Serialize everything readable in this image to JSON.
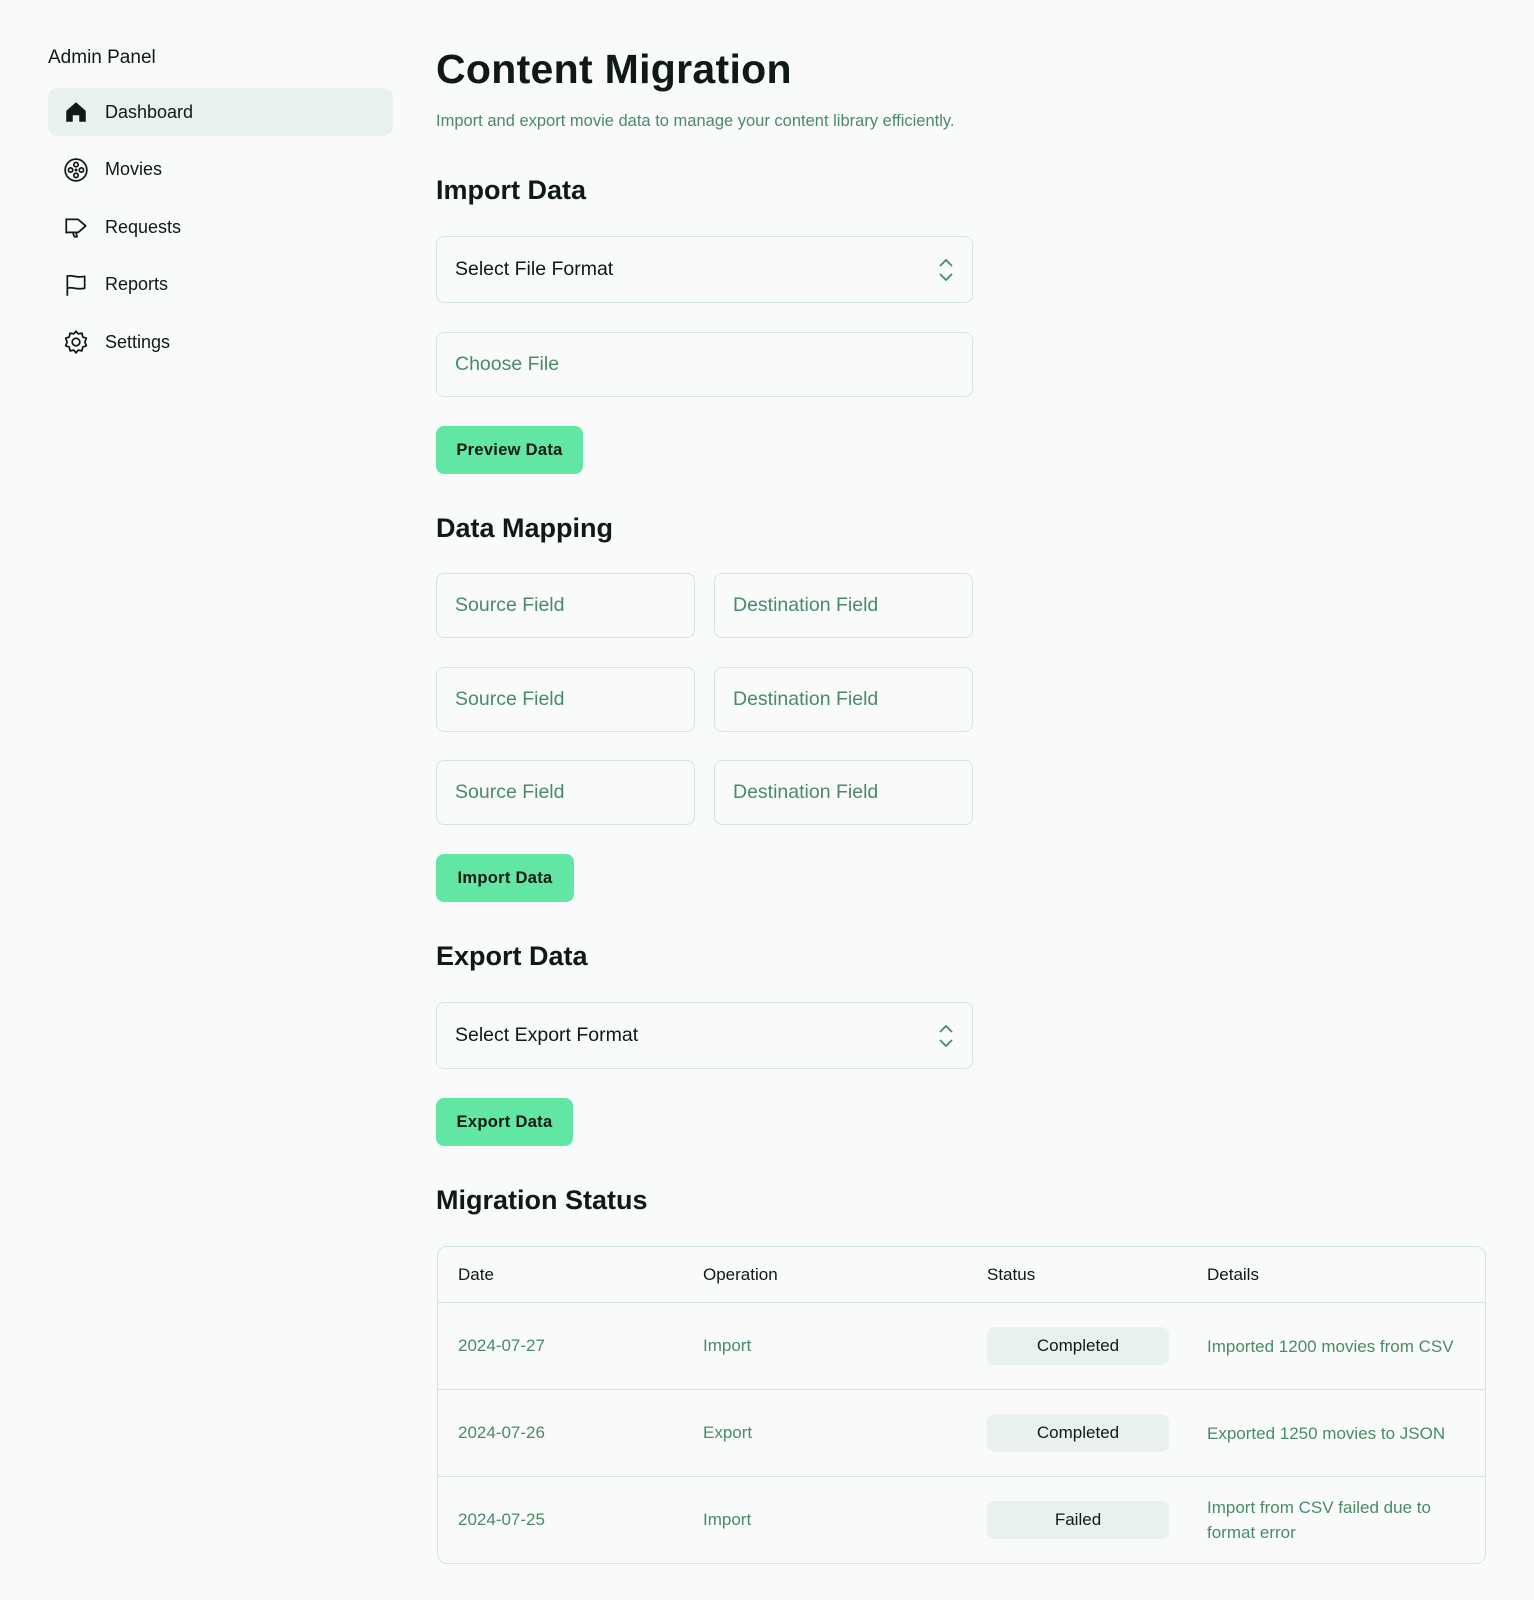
{
  "sidebar": {
    "title": "Admin Panel",
    "items": [
      {
        "label": "Dashboard",
        "icon": "home-icon",
        "active": true
      },
      {
        "label": "Movies",
        "icon": "film-reel-icon",
        "active": false
      },
      {
        "label": "Requests",
        "icon": "megaphone-icon",
        "active": false
      },
      {
        "label": "Reports",
        "icon": "flag-icon",
        "active": false
      },
      {
        "label": "Settings",
        "icon": "gear-icon",
        "active": false
      }
    ]
  },
  "header": {
    "title": "Content Migration",
    "subtitle": "Import and export movie data to manage your content library efficiently."
  },
  "import_section": {
    "title": "Import Data",
    "file_format_select": "Select File Format",
    "choose_file_placeholder": "Choose File",
    "preview_button": "Preview Data"
  },
  "mapping_section": {
    "title": "Data Mapping",
    "rows": [
      {
        "source_placeholder": "Source Field",
        "destination_placeholder": "Destination Field"
      },
      {
        "source_placeholder": "Source Field",
        "destination_placeholder": "Destination Field"
      },
      {
        "source_placeholder": "Source Field",
        "destination_placeholder": "Destination Field"
      }
    ],
    "import_button": "Import Data"
  },
  "export_section": {
    "title": "Export Data",
    "format_select": "Select Export Format",
    "export_button": "Export Data"
  },
  "status_section": {
    "title": "Migration Status",
    "columns": [
      "Date",
      "Operation",
      "Status",
      "Details"
    ],
    "rows": [
      {
        "date": "2024-07-27",
        "operation": "Import",
        "status": "Completed",
        "details": "Imported 1200 movies from CSV"
      },
      {
        "date": "2024-07-26",
        "operation": "Export",
        "status": "Completed",
        "details": "Exported 1250 movies to JSON"
      },
      {
        "date": "2024-07-25",
        "operation": "Import",
        "status": "Failed",
        "details": "Import from CSV failed due to format error"
      }
    ]
  },
  "colors": {
    "background": "#f8fbfa",
    "accent": "#62e6a3",
    "muted_text": "#4a8a66",
    "border": "#d3e5db",
    "active_nav": "#e8f1ec"
  }
}
